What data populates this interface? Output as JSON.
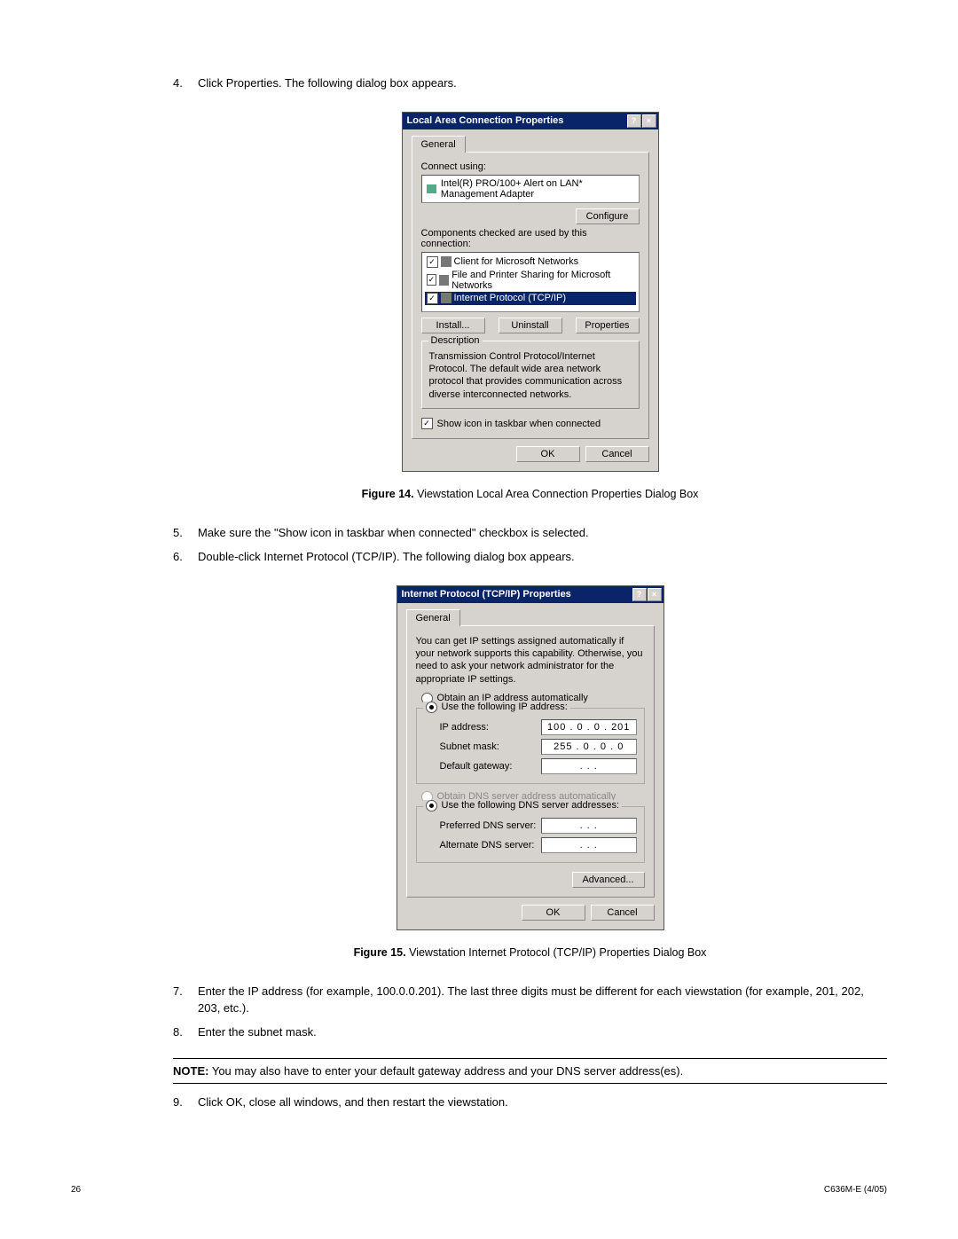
{
  "steps": {
    "s4": {
      "num": "4.",
      "text": "Click Properties. The following dialog box appears."
    },
    "s5": {
      "num": "5.",
      "text": "Make sure the \"Show icon in taskbar when connected\" checkbox is selected."
    },
    "s6": {
      "num": "6.",
      "text": "Double-click Internet Protocol (TCP/IP). The following dialog box appears."
    },
    "s7": {
      "num": "7.",
      "text": "Enter the IP address (for example, 100.0.0.201). The last three digits must be different for each viewstation (for example, 201, 202, 203, etc.)."
    },
    "s8": {
      "num": "8.",
      "text": "Enter the subnet mask."
    },
    "s9": {
      "num": "9.",
      "text": "Click OK, close all windows, and then restart the viewstation."
    }
  },
  "dialog1": {
    "title": "Local Area Connection Properties",
    "help": "?",
    "close": "×",
    "tab": "General",
    "connect_using": "Connect using:",
    "adapter": "Intel(R) PRO/100+ Alert on LAN* Management Adapter",
    "configure": "Configure",
    "components_label": "Components checked are used by this connection:",
    "components": [
      "Client for Microsoft Networks",
      "File and Printer Sharing for Microsoft Networks",
      "Internet Protocol (TCP/IP)"
    ],
    "install": "Install...",
    "uninstall": "Uninstall",
    "properties": "Properties",
    "description_label": "Description",
    "description": "Transmission Control Protocol/Internet Protocol. The default wide area network protocol that provides communication across diverse interconnected networks.",
    "show_icon": "Show icon in taskbar when connected",
    "ok": "OK",
    "cancel": "Cancel"
  },
  "figure14": {
    "label": "Figure 14.",
    "text": "Viewstation Local Area Connection Properties Dialog Box"
  },
  "dialog2": {
    "title": "Internet Protocol (TCP/IP) Properties",
    "help": "?",
    "close": "×",
    "tab": "General",
    "intro": "You can get IP settings assigned automatically if your network supports this capability. Otherwise, you need to ask your network administrator for the appropriate IP settings.",
    "obtain_auto": "Obtain an IP address automatically",
    "use_following": "Use the following IP address:",
    "ip_label": "IP address:",
    "ip_value": "100 .  0  .  0  . 201",
    "subnet_label": "Subnet mask:",
    "subnet_value": "255 .  0  .  0  .  0",
    "gateway_label": "Default gateway:",
    "gateway_value": " .       .       . ",
    "obtain_dns_auto": "Obtain DNS server address automatically",
    "use_dns": "Use the following DNS server addresses:",
    "pref_dns": "Preferred DNS server:",
    "pref_dns_value": " .       .       . ",
    "alt_dns": "Alternate DNS server:",
    "alt_dns_value": " .       .       . ",
    "advanced": "Advanced...",
    "ok": "OK",
    "cancel": "Cancel"
  },
  "figure15": {
    "label": "Figure 15.",
    "text": "Viewstation Internet Protocol (TCP/IP) Properties Dialog Box"
  },
  "note": {
    "label": "NOTE:",
    "text": "You may also have to enter your default gateway address and your DNS server address(es)."
  },
  "footer": {
    "page": "26",
    "doc": "C636M-E (4/05)"
  }
}
